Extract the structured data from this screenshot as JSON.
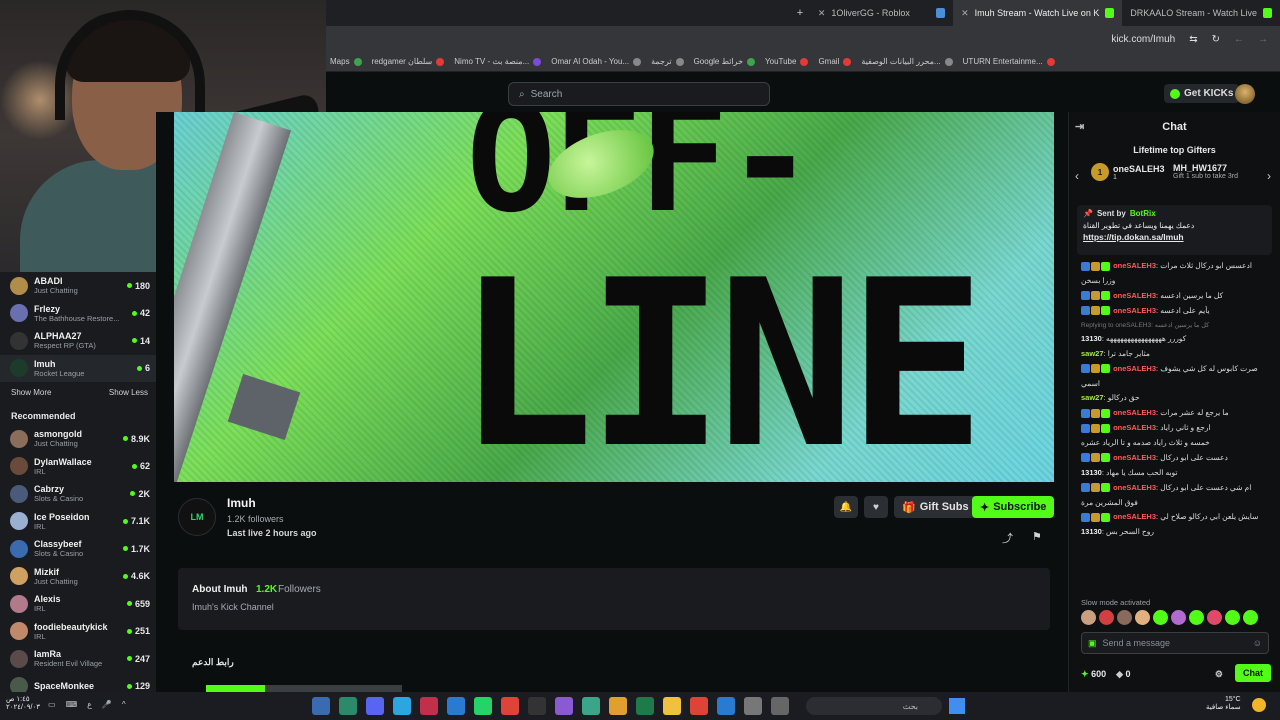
{
  "browser": {
    "tabs": [
      {
        "label": "1OliverGG - Roblox",
        "color": "#4a90d9"
      },
      {
        "label": "Imuh Stream - Watch Live on K",
        "color": "#53fc18",
        "active": true
      },
      {
        "label": "DRKAALO Stream - Watch Live",
        "color": "#53fc18"
      }
    ],
    "new_tab": "+",
    "url": "kick.com/Imuh",
    "bookmarks": [
      "Maps",
      "redgamer سلطان",
      "Nimo TV - منصة بث...",
      "Omar Al Odah - You...",
      "ترجمة",
      "Google خرائط",
      "YouTube",
      "Gmail",
      "محرر البيانات الوصفية...",
      "UTURN Entertainme..."
    ]
  },
  "header": {
    "search_placeholder": "Search",
    "get_kicks_label": "Get KICKs"
  },
  "sidebar": {
    "following": [
      {
        "name": "ABADI",
        "category": "Just Chatting",
        "count": "180",
        "color": "#b08e4a"
      },
      {
        "name": "Frlezy",
        "category": "The Bathhouse Restore...",
        "count": "42",
        "color": "#6a6fb0"
      },
      {
        "name": "ALPHAA27",
        "category": "Respect RP (GTA)",
        "count": "14",
        "color": "#333"
      },
      {
        "name": "Imuh",
        "category": "Rocket League",
        "count": "6",
        "color": "#1d3b2a",
        "active": true
      }
    ],
    "show_more": "Show More",
    "show_less": "Show Less",
    "recommended_title": "Recommended",
    "recommended": [
      {
        "name": "asmongold",
        "category": "Just Chatting",
        "count": "8.9K",
        "color": "#8a6d5a"
      },
      {
        "name": "DylanWallace",
        "category": "IRL",
        "count": "62",
        "color": "#6a4a3a"
      },
      {
        "name": "Cabrzy",
        "category": "Slots & Casino",
        "count": "2K",
        "color": "#4a5a7a"
      },
      {
        "name": "Ice Poseidon",
        "category": "IRL",
        "count": "7.1K",
        "color": "#9ab0d0"
      },
      {
        "name": "Classybeef",
        "category": "Slots & Casino",
        "count": "1.7K",
        "color": "#3a6ab0"
      },
      {
        "name": "Mizkif",
        "category": "Just Chatting",
        "count": "4.6K",
        "color": "#d0a060"
      },
      {
        "name": "Alexis",
        "category": "IRL",
        "count": "659",
        "color": "#b07a8a"
      },
      {
        "name": "foodiebeautykick",
        "category": "IRL",
        "count": "251",
        "color": "#c08a6a"
      },
      {
        "name": "IamRa",
        "category": "Resident Evil Village",
        "count": "247",
        "color": "#5a4a4a"
      },
      {
        "name": "SpaceMonkee",
        "category": "",
        "count": "129",
        "color": "#4a5a4a"
      }
    ]
  },
  "player": {
    "line1": "OFF-",
    "line2": "LINE"
  },
  "channel": {
    "avatar_text": "LM",
    "name": "Imuh",
    "followers": "1.2K followers",
    "last_live": "Last live 2 hours ago",
    "gift_label": "Gift Subs",
    "subscribe_label": "Subscribe",
    "about_title": "About Imuh",
    "about_count": "1.2K",
    "about_count_label": "Followers",
    "about_desc": "Imuh's Kick Channel",
    "support_label": "رابط الدعم"
  },
  "chat": {
    "title": "Chat",
    "gifters_title": "Lifetime top Gifters",
    "gifter1": {
      "rank": "1",
      "name": "oneSALEH3",
      "amount": "1"
    },
    "gifter2": {
      "name": "MH_HW1677",
      "amount": "1",
      "sub": "Gift 1 sub to take 3rd"
    },
    "pinned": {
      "sent_by": "Sent by",
      "bot": "BotRix",
      "message": "دعمك يهمنا ويساعد في تطوير القناة",
      "link": "https://tip.dokan.sa/Imuh"
    },
    "messages": [
      {
        "user": "oneSALEH3",
        "color": "red",
        "text": "ادعسس ابو دركال ثلاث مرات"
      },
      {
        "user": "",
        "color": "white",
        "text": "وزرا بسخن"
      },
      {
        "user": "oneSALEH3",
        "color": "red",
        "text": "كل ما يرسين ادعسه"
      },
      {
        "user": "oneSALEH3",
        "color": "red",
        "text": "يأيم على ادعسه"
      },
      {
        "user": "",
        "color": "reply",
        "text": "Replying to oneSALEH3: كل ما يرسين ادعسه"
      },
      {
        "user": "13130",
        "color": "white",
        "text": "كوررر ههههههههههههههههه"
      },
      {
        "user": "saw27",
        "color": "green",
        "text": "مثاير جامد ترا"
      },
      {
        "user": "oneSALEH3",
        "color": "red",
        "text": "صرت كابوس له كل شي يشوف"
      },
      {
        "user": "",
        "color": "white",
        "text": "اسمي"
      },
      {
        "user": "saw27",
        "color": "green",
        "text": "حق دركالو"
      },
      {
        "user": "oneSALEH3",
        "color": "red",
        "text": "ما يرجع له عشر مرات"
      },
      {
        "user": "oneSALEH3",
        "color": "red",
        "text": "ارجع و ثاني راياد"
      },
      {
        "user": "",
        "color": "white",
        "text": "خمسه و ثلاث راياد صدمه و تا الرياد عشره"
      },
      {
        "user": "oneSALEH3",
        "color": "red",
        "text": "دعست على ابو دركال"
      },
      {
        "user": "13130",
        "color": "white",
        "text": "توبه الحب مسك يا مهاد"
      },
      {
        "user": "oneSALEH3",
        "color": "red",
        "text": "ام شي دعست على ابو دركال"
      },
      {
        "user": "",
        "color": "white",
        "text": "فوق المشرين مرة"
      },
      {
        "user": "oneSALEH3",
        "color": "red",
        "text": "سايش يلعن ابي دركالو صلاح لي"
      },
      {
        "user": "13130",
        "color": "white",
        "text": "روح السحر بس"
      }
    ],
    "slow_mode": "Slow mode activated",
    "input_placeholder": "Send a message",
    "kicks_count": "600",
    "points_count": "0",
    "chat_button": "Chat"
  },
  "taskbar": {
    "time": "١:٤٥ ص",
    "date": "٢٠٢٤/٠٩/٠٣",
    "search_placeholder": "بحث",
    "temperature": "15°C",
    "weather": "سماء صافية"
  }
}
